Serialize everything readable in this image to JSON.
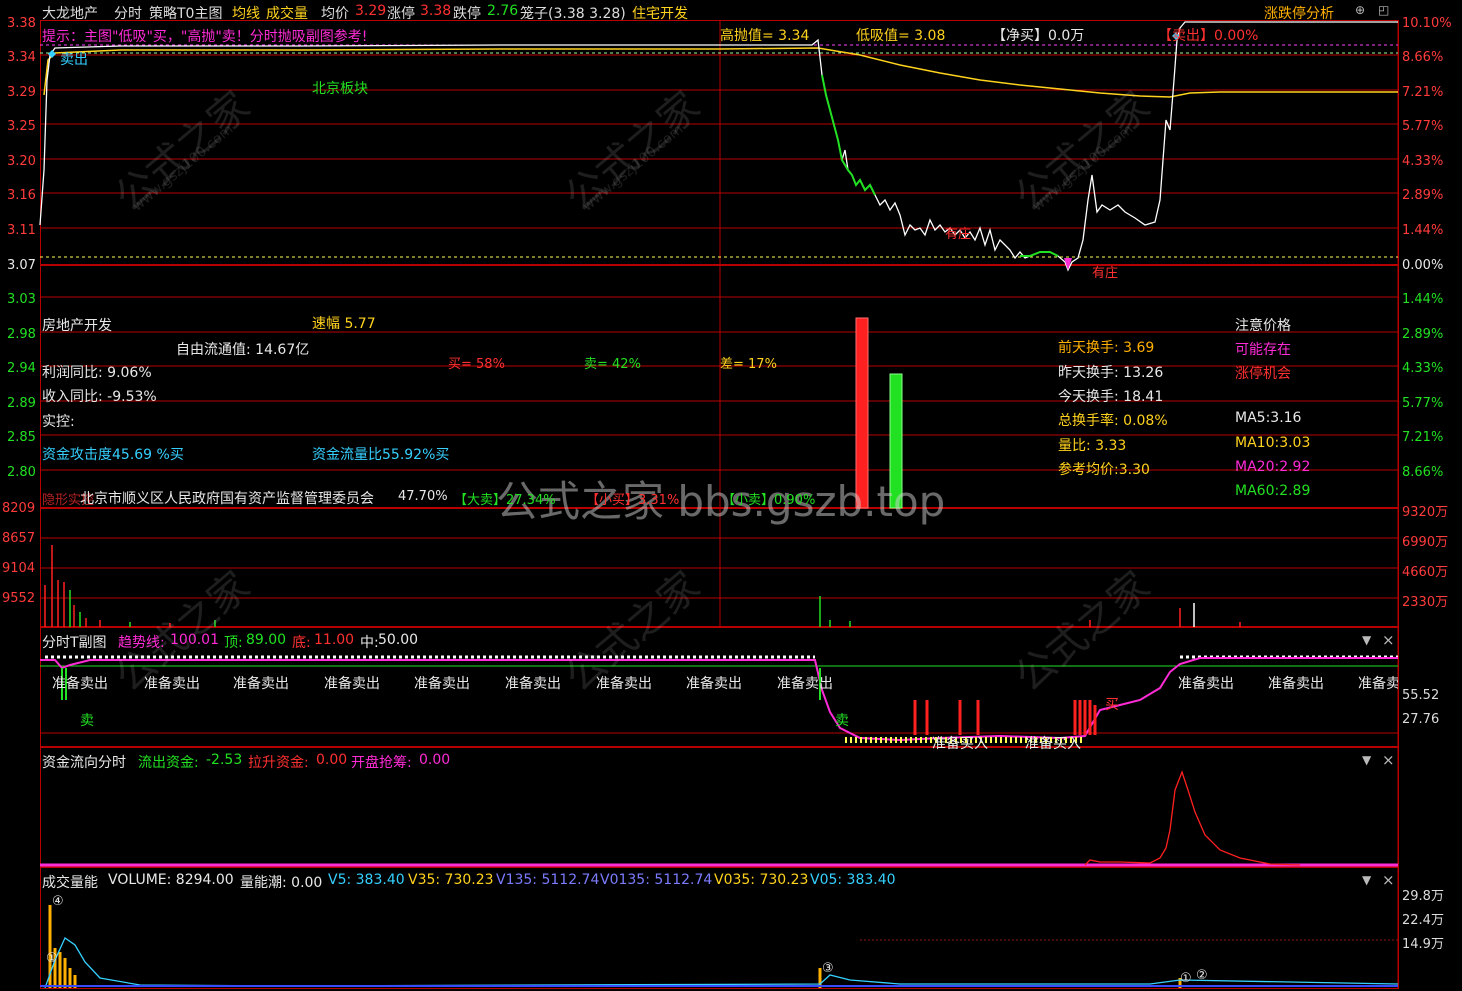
{
  "header": {
    "stock_name": "大龙地产",
    "mode": "分时",
    "strategy": "策略T0主图",
    "avg_label": "均线",
    "vol_label": "成交量",
    "price_label": "均价",
    "price": "3.29",
    "limit_up_label": "涨停",
    "limit_up": "3.38",
    "limit_down_label": "跌停",
    "limit_down": "2.76",
    "cage_label": "笼子(3.38 3.28)",
    "sector": "住宅开发",
    "right_title": "涨跌停分析"
  },
  "top_info": {
    "tip": "提示：主图\"低吸\"买，\"高抛\"卖！分时抛吸副图参考!",
    "high_sell": "高抛值= 3.34",
    "low_buy": "低吸值= 3.08",
    "net_buy": "【净买】0.0万",
    "sell_pct": "【卖出】0.00%",
    "buy_sell_tag": "卖出",
    "beijing": "北京板块",
    "youzhuang1": "有庄",
    "youzhuang2": "有庄"
  },
  "price_axis": [
    "3.38",
    "3.34",
    "3.29",
    "3.25",
    "3.20",
    "3.16",
    "3.11",
    "3.07",
    "3.03",
    "2.98",
    "2.94",
    "2.89",
    "2.85",
    "2.80"
  ],
  "pct_axis": [
    "10.10%",
    "8.66%",
    "7.21%",
    "5.77%",
    "4.33%",
    "2.89%",
    "1.44%",
    "0.00%",
    "1.44%",
    "2.89%",
    "4.33%",
    "5.77%",
    "7.21%",
    "8.66%"
  ],
  "vol_left_axis": [
    "8209",
    "8657",
    "9104",
    "9552"
  ],
  "vol_right_axis": [
    "9320万",
    "6990万",
    "4660万",
    "2330万"
  ],
  "info": {
    "industry": "房地产开发",
    "speed": "速幅 5.77",
    "float_cap": "自由流通值: 14.67亿",
    "profit_yoy": "利润同比: 9.06%",
    "revenue_yoy": "收入同比: -9.53%",
    "controller_label": "实控:",
    "attack": "资金攻击度45.69 %买",
    "flow_ratio": "资金流量比55.92%买",
    "buy_pct": "买= 58%",
    "sell_pct": "卖= 42%",
    "diff_pct": "差= 17%",
    "controller": "北京市顺义区人民政府国有资产监督管理委员会",
    "controller_pct": "47.70%",
    "big_sell": "【大卖】27.34%",
    "small_buy": "【小买】3.31%",
    "small_sell": "【小卖】0.90%",
    "hidden_label": "隐形实控"
  },
  "turnover": {
    "prev2": "前天换手: 3.69",
    "prev1": "昨天换手: 13.26",
    "today": "今天换手: 18.41",
    "total": "总换手率: 0.08%",
    "vol_ratio": "量比: 3.33",
    "ref_avg": "参考均价:3.30"
  },
  "notice": {
    "title": "注意价格",
    "may_exist": "可能存在",
    "limit_up_chance": "涨停机会",
    "ma5": "MA5:3.16",
    "ma10": "MA10:3.03",
    "ma20": "MA20:2.92",
    "ma60": "MA60:2.89"
  },
  "watermark": "公式之家 bbs.gszb.top",
  "watermark_small": "公式之家",
  "watermark_url": "www.gszj100.com",
  "panel_t": {
    "title": "分时T副图",
    "trend_label": "趋势线:",
    "trend_val": "100.01",
    "top_label": "顶:",
    "top_val": "89.00",
    "bottom_label": "底:",
    "bottom_val": "11.00",
    "mid_label": "中:",
    "mid_val": "50.00",
    "ready_sell": "准备卖出",
    "ready_buy": "准备买入",
    "buy_mark": "买",
    "sell_mark": "卖",
    "axis": [
      "55.52",
      "27.76"
    ]
  },
  "panel_flow": {
    "title": "资金流向分时",
    "out_label": "流出资金:",
    "out_val": "-2.53",
    "pull_label": "拉升资金:",
    "pull_val": "0.00",
    "open_label": "开盘抢筹:",
    "open_val": "0.00"
  },
  "panel_vol": {
    "title": "成交量能",
    "volume": "VOLUME: 8294.00",
    "tide": "量能潮: 0.00",
    "v5": "V5: 383.40",
    "v35": "V35: 730.23",
    "v135": "V135: 5112.74",
    "v0135": "V0135: 5112.74",
    "v035": "V035: 730.23",
    "v05": "V05: 383.40",
    "axis": [
      "29.8万",
      "22.4万",
      "14.9万"
    ],
    "markers": [
      "④",
      "①",
      "③",
      "①",
      "②"
    ]
  },
  "controls": {
    "close": "×",
    "dropdown": "▼",
    "icon_up": "⊕",
    "icon_win": "◰"
  },
  "colors": {
    "grid": "#b80000",
    "price": "#ffffff",
    "avg": "#ffd21e",
    "up": "#ff2020",
    "down": "#22e022"
  }
}
